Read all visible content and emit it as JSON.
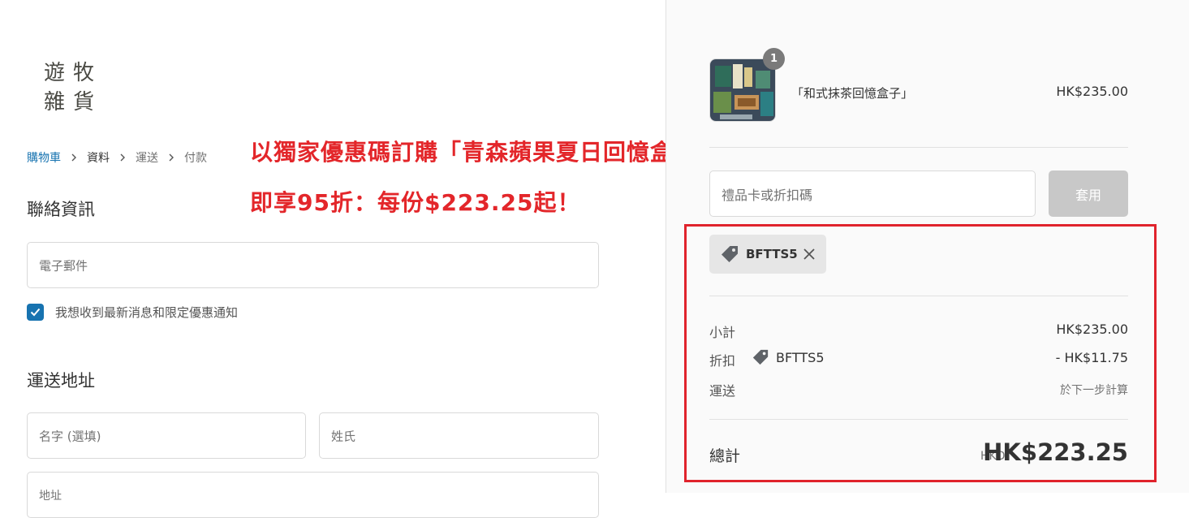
{
  "brand": {
    "logo_line1": "遊牧",
    "logo_line2": "雜貨"
  },
  "breadcrumb": [
    {
      "label": "購物車",
      "state": "active"
    },
    {
      "label": "資料",
      "state": "current"
    },
    {
      "label": "運送",
      "state": "pending"
    },
    {
      "label": "付款",
      "state": "pending"
    }
  ],
  "promo": {
    "line1": "以獨家優惠碼訂購「青森蘋果夏日回憶盒子」",
    "line2": "即享95折：每份$223.25起！"
  },
  "contact": {
    "heading": "聯絡資訊",
    "email_placeholder": "電子郵件",
    "newsletter_label": "我想收到最新消息和限定優惠通知",
    "newsletter_checked": true
  },
  "shipping": {
    "heading": "運送地址",
    "first_name_placeholder": "名字 (選填)",
    "last_name_placeholder": "姓氏",
    "address_placeholder": "地址"
  },
  "order": {
    "item": {
      "name": "「和式抹茶回憶盒子」",
      "price": "HK$235.00",
      "quantity": "1"
    },
    "gift_placeholder": "禮品卡或折扣碼",
    "apply_label": "套用",
    "applied_code": "BFTTS5",
    "subtotal_label": "小計",
    "subtotal_value": "HK$235.00",
    "discount_label": "折扣",
    "discount_code": "BFTTS5",
    "discount_value": "- HK$11.75",
    "shipping_label": "運送",
    "shipping_value": "於下一步計算",
    "total_label": "總計",
    "total_currency": "HKD",
    "total_value": "HK$223.25"
  },
  "colors": {
    "accent": "#1773b0",
    "promo_red": "#e3262a",
    "highlight_box": "#e0232c"
  },
  "icons": [
    "tag-icon",
    "close-icon",
    "check-icon",
    "chevron-right-icon"
  ]
}
